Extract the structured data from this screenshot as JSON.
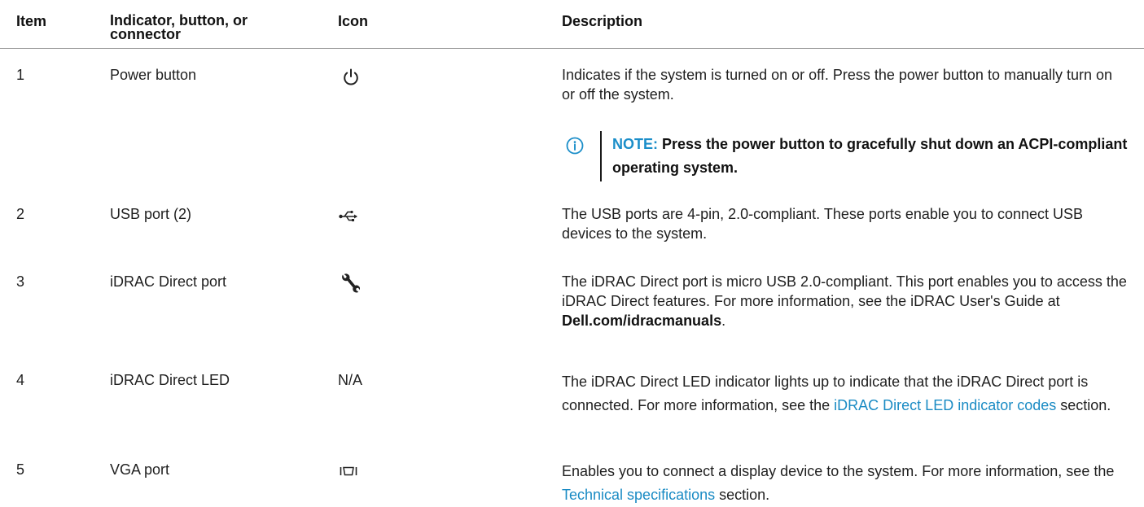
{
  "headers": {
    "item": "Item",
    "indicator": "Indicator, button, or connector",
    "icon": "Icon",
    "description": "Description"
  },
  "rows": [
    {
      "item": "1",
      "name": "Power button",
      "icon_name": "power-icon",
      "description": "Indicates if the system is turned on or off. Press the power button to manually turn on or off the system."
    },
    {
      "item": "2",
      "name": "USB port (2)",
      "icon_name": "usb-icon",
      "description": "The USB ports are 4-pin, 2.0-compliant. These ports enable you to connect USB devices to the system."
    },
    {
      "item": "3",
      "name": "iDRAC Direct port",
      "icon_name": "wrench-icon",
      "description_pre": "The iDRAC Direct port is micro USB 2.0-compliant. This port enables you to access the iDRAC Direct features. For more information, see the iDRAC User's Guide at ",
      "description_bold": "Dell.com/idracmanuals",
      "description_post": "."
    },
    {
      "item": "4",
      "name": "iDRAC Direct LED",
      "icon_text": "N/A",
      "description_pre": "The iDRAC Direct LED indicator lights up to indicate that the iDRAC Direct port is connected. For more information, see the ",
      "description_link": "iDRAC Direct LED indicator codes",
      "description_post": " section."
    },
    {
      "item": "5",
      "name": "VGA port",
      "icon_name": "vga-icon",
      "description_pre": "Enables you to connect a display device to the system. For more information, see the ",
      "description_link": "Technical specifications",
      "description_post": " section."
    }
  ],
  "note": {
    "label": "NOTE:",
    "text": "Press the power button to gracefully shut down an ACPI-compliant operating system.",
    "icon_name": "info-icon"
  },
  "colors": {
    "link": "#1a8bc4",
    "note_label": "#1b8ec9",
    "rule": "#9a9a9a"
  }
}
